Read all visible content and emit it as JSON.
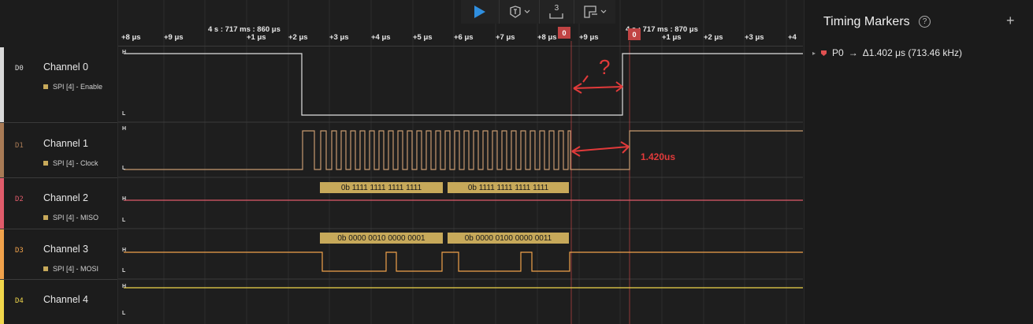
{
  "toolbar": {
    "play_icon": "play-icon",
    "trigger_icon": "trigger-icon",
    "measure_label": "3",
    "layout_icon": "layout-icon"
  },
  "ruler": {
    "abs_left": "4 s : 717 ms : 860 μs",
    "abs_right": "4 s : 717 ms : 870 μs",
    "ticks": [
      "+8 μs",
      "+9 μs",
      "+1 μs",
      "+2 μs",
      "+3 μs",
      "+4 μs",
      "+5 μs",
      "+6 μs",
      "+7 μs",
      "+8 μs",
      "+9 μs",
      "+1 μs",
      "+2 μs",
      "+3 μs",
      "+4"
    ],
    "marker_flags": [
      "0",
      "0"
    ]
  },
  "channels": [
    {
      "tag": "D0",
      "name": "Channel 0",
      "sub": "SPI [4] - Enable",
      "color": "#d9d9d9"
    },
    {
      "tag": "D1",
      "name": "Channel 1",
      "sub": "SPI [4] - Clock",
      "color": "#a87a55"
    },
    {
      "tag": "D2",
      "name": "Channel 2",
      "sub": "SPI [4] - MISO",
      "color": "#e05b6a"
    },
    {
      "tag": "D3",
      "name": "Channel 3",
      "sub": "SPI [4] - MOSI",
      "color": "#f0a24b"
    },
    {
      "tag": "D4",
      "name": "Channel 4",
      "sub": "",
      "color": "#f0d64b"
    }
  ],
  "levels": {
    "high": "H",
    "low": "L"
  },
  "decodes": {
    "miso": [
      "0b 1111 1111 1111 1111",
      "0b 1111 1111 1111 1111"
    ],
    "mosi": [
      "0b 0000 0010 0000 0001",
      "0b 0000 0100 0000 0011"
    ]
  },
  "annotations": {
    "question": "?",
    "measure": "1.420us"
  },
  "panel": {
    "title": "Timing Markers",
    "help": "?",
    "add": "+",
    "marker_name": "P0",
    "arrow": "→",
    "marker_value": "Δ1.402 μs (713.46 kHz)"
  }
}
